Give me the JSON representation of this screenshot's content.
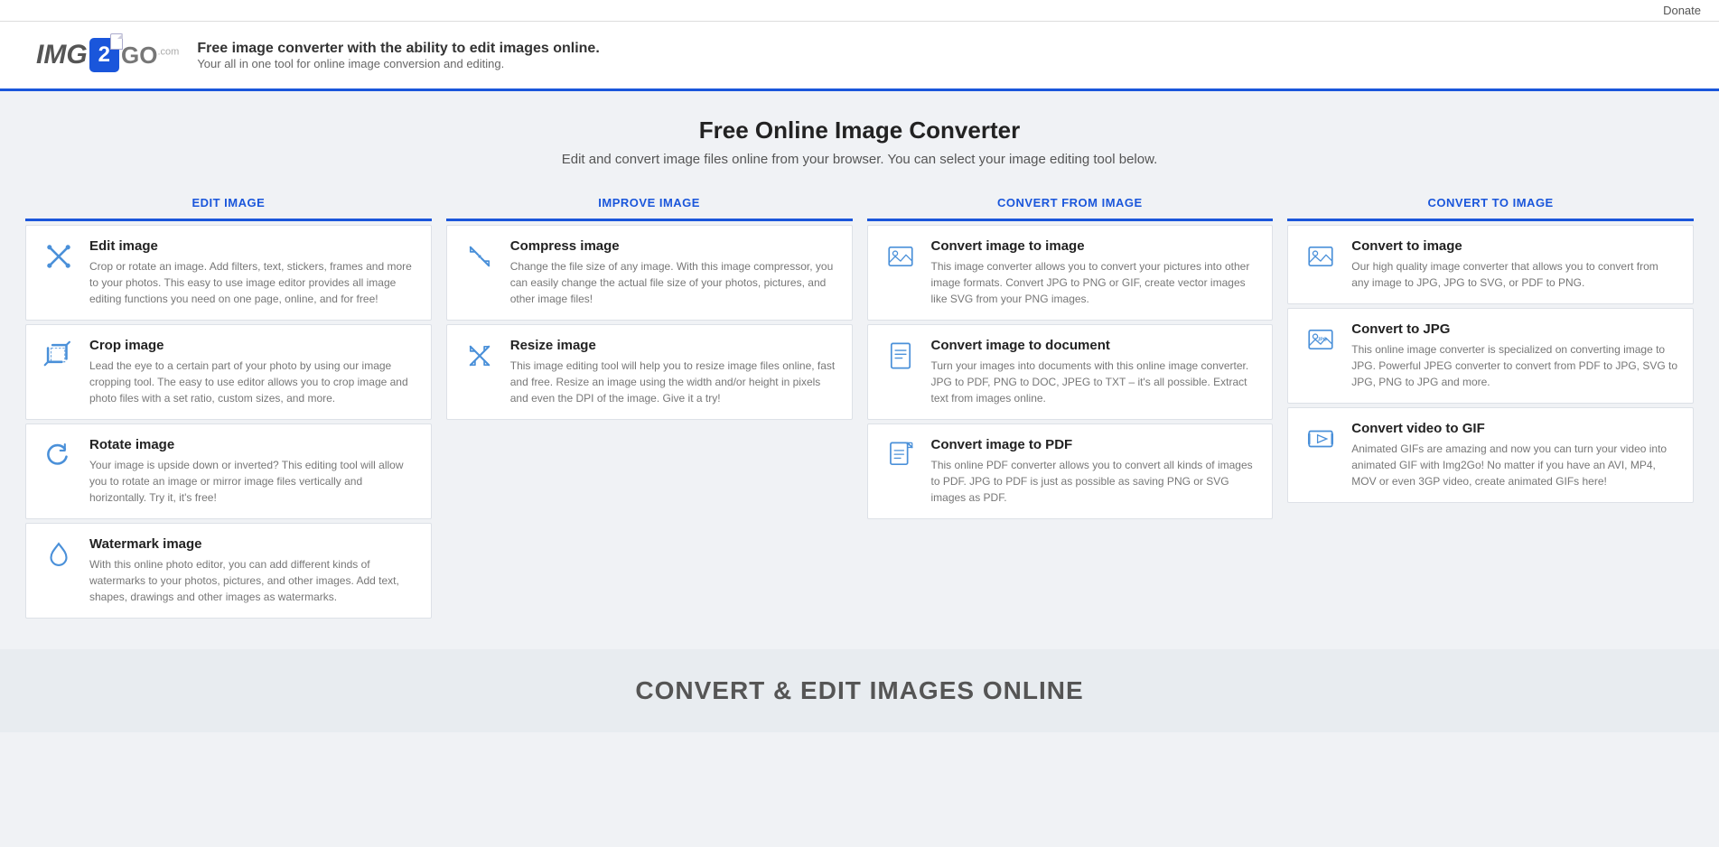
{
  "topbar": {
    "donate_label": "Donate"
  },
  "header": {
    "logo_img": "IMG",
    "logo_2": "2",
    "logo_go": "GO",
    "logo_com": ".com",
    "tagline_heading": "Free image converter with the ability to edit images online.",
    "tagline_sub": "Your all in one tool for online image conversion and editing."
  },
  "hero": {
    "title": "Free Online Image Converter",
    "subtitle": "Edit and convert image files online from your browser. You can select your image editing tool below."
  },
  "columns": [
    {
      "id": "edit-image",
      "header": "EDIT IMAGE",
      "cards": [
        {
          "icon": "edit-icon",
          "title": "Edit image",
          "description": "Crop or rotate an image. Add filters, text, stickers, frames and more to your photos. This easy to use image editor provides all image editing functions you need on one page, online, and for free!"
        },
        {
          "icon": "crop-icon",
          "title": "Crop image",
          "description": "Lead the eye to a certain part of your photo by using our image cropping tool. The easy to use editor allows you to crop image and photo files with a set ratio, custom sizes, and more."
        },
        {
          "icon": "rotate-icon",
          "title": "Rotate image",
          "description": "Your image is upside down or inverted? This editing tool will allow you to rotate an image or mirror image files vertically and horizontally. Try it, it's free!"
        },
        {
          "icon": "watermark-icon",
          "title": "Watermark image",
          "description": "With this online photo editor, you can add different kinds of watermarks to your photos, pictures, and other images. Add text, shapes, drawings and other images as watermarks."
        }
      ]
    },
    {
      "id": "improve-image",
      "header": "IMPROVE IMAGE",
      "cards": [
        {
          "icon": "compress-icon",
          "title": "Compress image",
          "description": "Change the file size of any image. With this image compressor, you can easily change the actual file size of your photos, pictures, and other image files!"
        },
        {
          "icon": "resize-icon",
          "title": "Resize image",
          "description": "This image editing tool will help you to resize image files online, fast and free. Resize an image using the width and/or height in pixels and even the DPI of the image. Give it a try!"
        }
      ]
    },
    {
      "id": "convert-from-image",
      "header": "CONVERT FROM IMAGE",
      "cards": [
        {
          "icon": "convert-image-icon",
          "title": "Convert image to image",
          "description": "This image converter allows you to convert your pictures into other image formats. Convert JPG to PNG or GIF, create vector images like SVG from your PNG images."
        },
        {
          "icon": "convert-doc-icon",
          "title": "Convert image to document",
          "description": "Turn your images into documents with this online image converter. JPG to PDF, PNG to DOC, JPEG to TXT – it's all possible. Extract text from images online."
        },
        {
          "icon": "convert-pdf-icon",
          "title": "Convert image to PDF",
          "description": "This online PDF converter allows you to convert all kinds of images to PDF. JPG to PDF is just as possible as saving PNG or SVG images as PDF."
        }
      ]
    },
    {
      "id": "convert-to-image",
      "header": "CONVERT TO IMAGE",
      "cards": [
        {
          "icon": "convert-to-icon",
          "title": "Convert to image",
          "description": "Our high quality image converter that allows you to convert from any image to JPG, JPG to SVG, or PDF to PNG."
        },
        {
          "icon": "convert-to-jpg-icon",
          "title": "Convert to JPG",
          "description": "This online image converter is specialized on converting image to JPG. Powerful JPEG converter to convert from PDF to JPG, SVG to JPG, PNG to JPG and more."
        },
        {
          "icon": "convert-video-gif-icon",
          "title": "Convert video to GIF",
          "description": "Animated GIFs are amazing and now you can turn your video into animated GIF with Img2Go! No matter if you have an AVI, MP4, MOV or even 3GP video, create animated GIFs here!"
        }
      ]
    }
  ],
  "footer_banner": {
    "title": "CONVERT & EDIT IMAGES ONLINE"
  }
}
